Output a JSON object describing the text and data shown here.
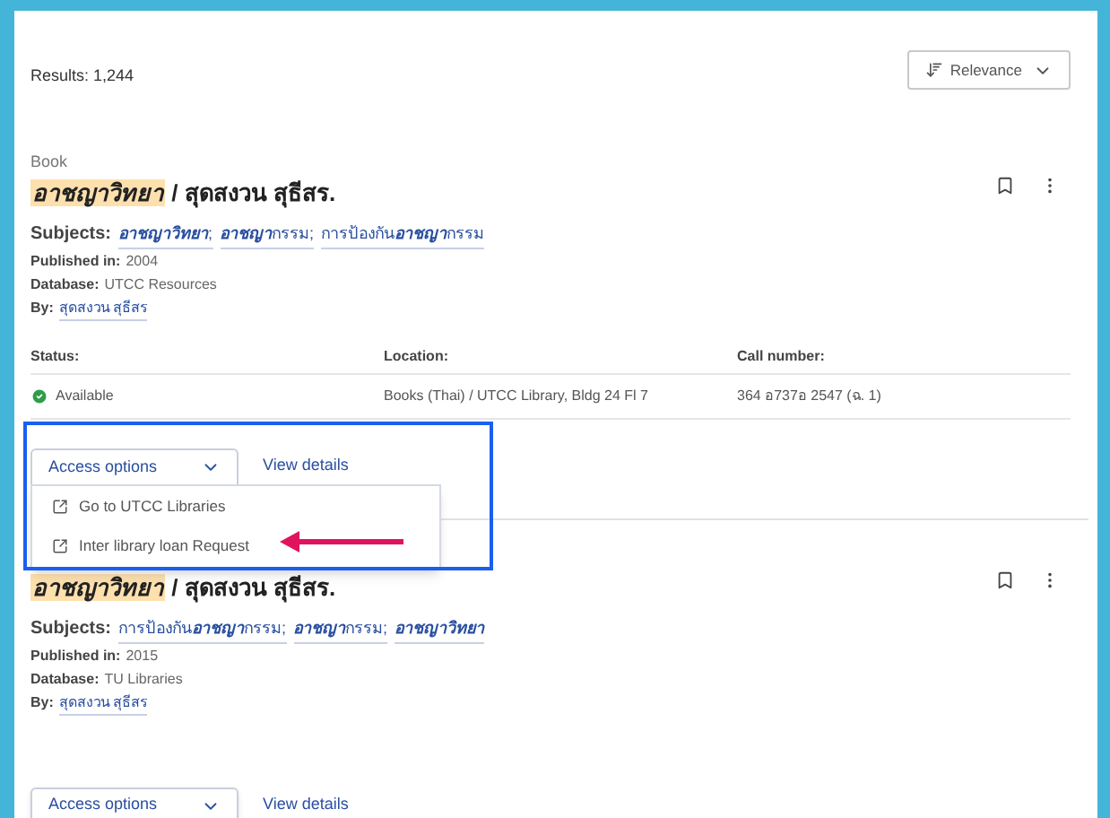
{
  "results": "Results: 1,244",
  "sort": {
    "label": "Relevance"
  },
  "records": [
    {
      "type": "Book",
      "title": [
        {
          "text": "อาชญาวิทยา",
          "match": true
        },
        {
          "text": " / สุดสงวน สุธีสร.",
          "match": false
        }
      ],
      "subjects_label": "Subjects:",
      "subjects": [
        [
          {
            "text": "อาชญาวิทยา",
            "match": true
          },
          {
            "text": ";",
            "match": false
          }
        ],
        [
          {
            "text": "อาชญา",
            "match": true
          },
          {
            "text": "กรรม;",
            "match": false
          }
        ],
        [
          {
            "text": "การป้องกัน",
            "match": false
          },
          {
            "text": "อาชญา",
            "match": true
          },
          {
            "text": "กรรม",
            "match": false
          }
        ]
      ],
      "fields": [
        {
          "label": "Published in:",
          "value": "2004"
        },
        {
          "label": "Database:",
          "value": "UTCC Resources"
        }
      ],
      "by_label": "By:",
      "author": "สุดสงวน สุธีสร",
      "holdings": {
        "headers": [
          "Status:",
          "Location:",
          "Call number:"
        ],
        "status": "Available",
        "available": true,
        "location": "Books (Thai) / UTCC Library, Bldg 24 Fl 7",
        "call_number": "364 อ737อ 2547 (ฉ. 1)"
      },
      "access_button": "Access options",
      "details_link": "View details",
      "menu": {
        "open": true,
        "items": [
          "Go to UTCC Libraries",
          "Inter library loan Request"
        ]
      }
    },
    {
      "title": [
        {
          "text": "อาชญาวิทยา",
          "match": true
        },
        {
          "text": " / สุดสงวน สุธีสร.",
          "match": false
        }
      ],
      "subjects_label": "Subjects:",
      "subjects": [
        [
          {
            "text": "การป้องกัน",
            "match": false
          },
          {
            "text": "อาชญา",
            "match": true
          },
          {
            "text": "กรรม;",
            "match": false
          }
        ],
        [
          {
            "text": "อาชญา",
            "match": true
          },
          {
            "text": "กรรม;",
            "match": false
          }
        ],
        [
          {
            "text": "อาชญาวิทยา",
            "match": true
          }
        ]
      ],
      "fields": [
        {
          "label": "Published in:",
          "value": "2015"
        },
        {
          "label": "Database:",
          "value": "TU Libraries"
        }
      ],
      "by_label": "By:",
      "author": "สุดสงวน สุธีสร",
      "access_button": "Access options",
      "details_link": "View details",
      "menu": {
        "open": false
      }
    }
  ]
}
